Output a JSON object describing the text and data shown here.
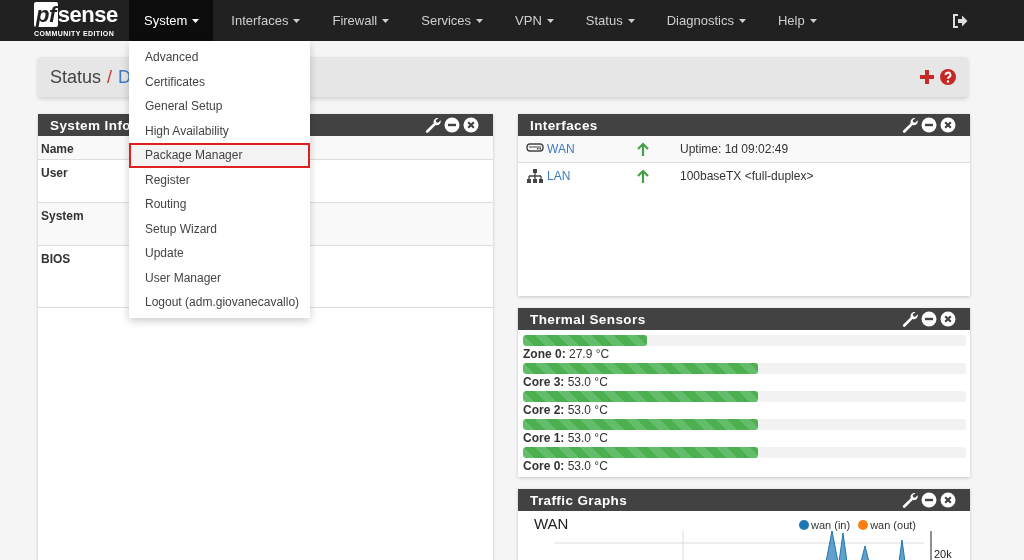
{
  "navbar": {
    "logo": {
      "mark": "pf",
      "text": "sense",
      "subtitle": "COMMUNITY EDITION"
    },
    "items": [
      {
        "label": "System",
        "selected": true
      },
      {
        "label": "Interfaces",
        "selected": false
      },
      {
        "label": "Firewall",
        "selected": false
      },
      {
        "label": "Services",
        "selected": false
      },
      {
        "label": "VPN",
        "selected": false
      },
      {
        "label": "Status",
        "selected": false
      },
      {
        "label": "Diagnostics",
        "selected": false
      },
      {
        "label": "Help",
        "selected": false
      }
    ]
  },
  "system_menu": {
    "items": [
      {
        "label": "Advanced",
        "highlighted": false
      },
      {
        "label": "Certificates",
        "highlighted": false
      },
      {
        "label": "General Setup",
        "highlighted": false
      },
      {
        "label": "High Availability",
        "highlighted": false
      },
      {
        "label": "Package Manager",
        "highlighted": true
      },
      {
        "label": "Register",
        "highlighted": false
      },
      {
        "label": "Routing",
        "highlighted": false
      },
      {
        "label": "Setup Wizard",
        "highlighted": false
      },
      {
        "label": "Update",
        "highlighted": false
      },
      {
        "label": "User Manager",
        "highlighted": false
      },
      {
        "label": "Logout (adm.giovanecavallo)",
        "highlighted": false
      }
    ]
  },
  "breadcrumb": {
    "root": "Status",
    "separator": "/",
    "current": "D"
  },
  "system_info": {
    "title": "System Info",
    "rows": [
      {
        "label": "Name"
      },
      {
        "label": "User"
      },
      {
        "label": "System"
      },
      {
        "label": "BIOS"
      }
    ]
  },
  "interfaces": {
    "title": "Interfaces",
    "rows": [
      {
        "name": "WAN",
        "kind": "wan",
        "link_up": true,
        "info": "Uptime: 1d 09:02:49"
      },
      {
        "name": "LAN",
        "kind": "lan",
        "link_up": true,
        "info": "100baseTX <full-duplex>"
      }
    ]
  },
  "thermal_sensors": {
    "title": "Thermal Sensors",
    "sensors": [
      {
        "text": "**Zone 0:** 27.9 °C",
        "level": 0.28
      },
      {
        "text": "**Core 3:** 53.0 °C",
        "level": 0.53
      },
      {
        "text": "**Core 2:** 53.0 °C",
        "level": 0.53
      },
      {
        "text": "**Core 1:** 53.0 °C",
        "level": 0.53
      },
      {
        "text": "**Core 0:** 53.0 °C",
        "level": 0.53
      }
    ]
  },
  "traffic_graphs": {
    "title": "Traffic Graphs",
    "graph_title": "WAN",
    "legend": [
      {
        "label": "wan (in)",
        "color": "#1f77b4"
      },
      {
        "label": "wan (out)",
        "color": "#ff7f0e"
      }
    ],
    "axis_label": "20k"
  }
}
